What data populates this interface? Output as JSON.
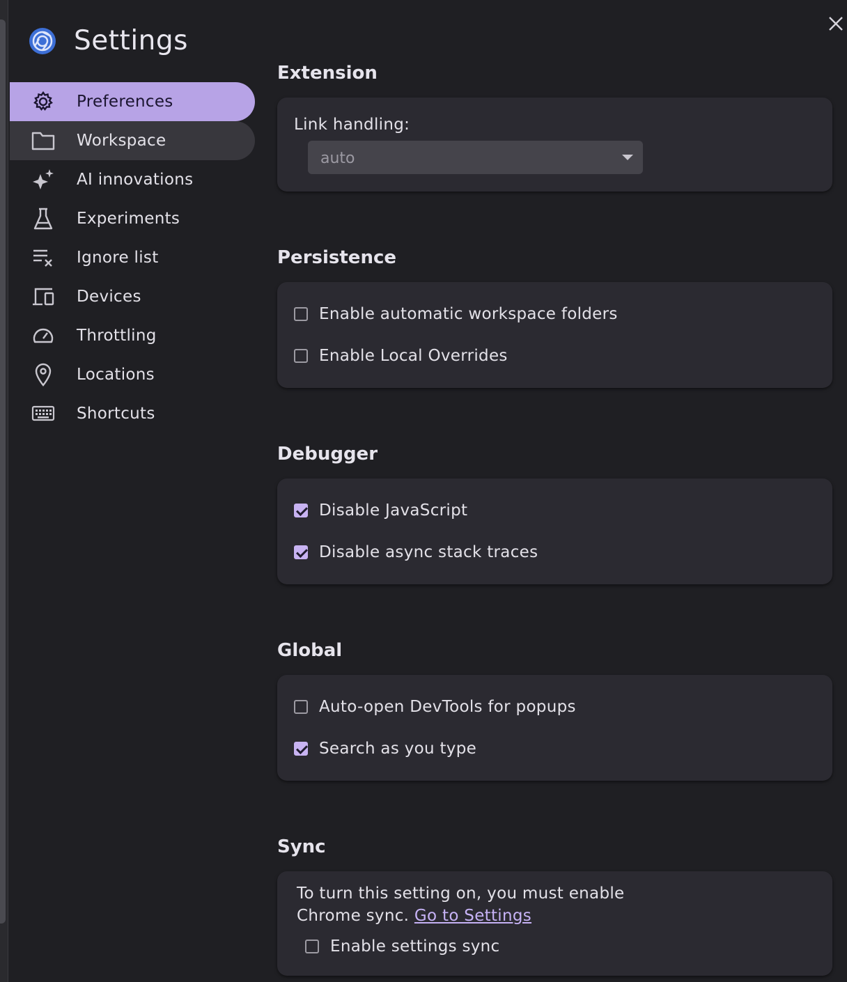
{
  "header": {
    "title": "Settings",
    "logo_icon": "chrome-devtools-logo-icon",
    "close_icon": "close-icon"
  },
  "colors": {
    "background": "#1f1f23",
    "card": "#2b2a31",
    "accent": "#b7a3e6",
    "link": "#c6b2f5"
  },
  "sidebar": {
    "items": [
      {
        "label": "Preferences",
        "icon": "gear-icon",
        "state": "active"
      },
      {
        "label": "Workspace",
        "icon": "folder-icon",
        "state": "hover"
      },
      {
        "label": "AI innovations",
        "icon": "sparkle-icon",
        "state": ""
      },
      {
        "label": "Experiments",
        "icon": "flask-icon",
        "state": ""
      },
      {
        "label": "Ignore list",
        "icon": "list-remove-icon",
        "state": ""
      },
      {
        "label": "Devices",
        "icon": "devices-icon",
        "state": ""
      },
      {
        "label": "Throttling",
        "icon": "speedometer-icon",
        "state": ""
      },
      {
        "label": "Locations",
        "icon": "location-pin-icon",
        "state": ""
      },
      {
        "label": "Shortcuts",
        "icon": "keyboard-icon",
        "state": ""
      }
    ]
  },
  "sections": {
    "extension": {
      "title": "Extension",
      "link_handling_label": "Link handling:",
      "link_handling_value": "auto"
    },
    "persistence": {
      "title": "Persistence",
      "options": [
        {
          "label": "Enable automatic workspace folders",
          "checked": false
        },
        {
          "label": "Enable Local Overrides",
          "checked": false
        }
      ]
    },
    "debugger": {
      "title": "Debugger",
      "options": [
        {
          "label": "Disable JavaScript",
          "checked": true
        },
        {
          "label": "Disable async stack traces",
          "checked": true
        }
      ]
    },
    "global": {
      "title": "Global",
      "options": [
        {
          "label": "Auto-open DevTools for popups",
          "checked": false
        },
        {
          "label": "Search as you type",
          "checked": true
        }
      ]
    },
    "sync": {
      "title": "Sync",
      "message_line1": "To turn this setting on, you must enable",
      "message_line2": "Chrome sync.",
      "link_text": "Go to Settings",
      "option": {
        "label": "Enable settings sync",
        "checked": false
      }
    }
  }
}
